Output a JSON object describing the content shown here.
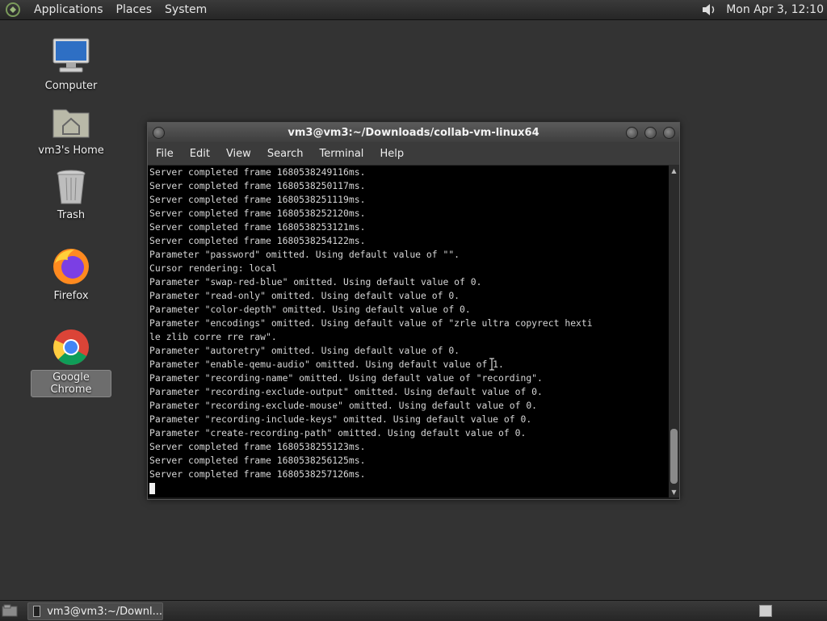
{
  "top_panel": {
    "menus": [
      "Applications",
      "Places",
      "System"
    ],
    "clock": "Mon Apr  3, 12:10"
  },
  "desktop": {
    "icons": [
      {
        "label": "Computer",
        "icon": "computer-icon"
      },
      {
        "label": "vm3's Home",
        "icon": "home-folder-icon"
      },
      {
        "label": "Trash",
        "icon": "trash-icon"
      },
      {
        "label": "Firefox",
        "icon": "firefox-icon"
      },
      {
        "label": "Google Chrome",
        "icon": "chrome-icon"
      }
    ]
  },
  "window": {
    "title": "vm3@vm3:~/Downloads/collab-vm-linux64",
    "menus": [
      "File",
      "Edit",
      "View",
      "Search",
      "Terminal",
      "Help"
    ]
  },
  "terminal": {
    "lines": [
      "Server completed frame 1680538249116ms.",
      "Server completed frame 1680538250117ms.",
      "Server completed frame 1680538251119ms.",
      "Server completed frame 1680538252120ms.",
      "Server completed frame 1680538253121ms.",
      "Server completed frame 1680538254122ms.",
      "Parameter \"password\" omitted. Using default value of \"\".",
      "Cursor rendering: local",
      "Parameter \"swap-red-blue\" omitted. Using default value of 0.",
      "Parameter \"read-only\" omitted. Using default value of 0.",
      "Parameter \"color-depth\" omitted. Using default value of 0.",
      "Parameter \"encodings\" omitted. Using default value of \"zrle ultra copyrect hexti",
      "le zlib corre rre raw\".",
      "Parameter \"autoretry\" omitted. Using default value of 0.",
      "Parameter \"enable-qemu-audio\" omitted. Using default value of 1.",
      "Parameter \"recording-name\" omitted. Using default value of \"recording\".",
      "Parameter \"recording-exclude-output\" omitted. Using default value of 0.",
      "Parameter \"recording-exclude-mouse\" omitted. Using default value of 0.",
      "Parameter \"recording-include-keys\" omitted. Using default value of 0.",
      "Parameter \"create-recording-path\" omitted. Using default value of 0.",
      "Server completed frame 1680538255123ms.",
      "Server completed frame 1680538256125ms.",
      "Server completed frame 1680538257126ms."
    ]
  },
  "taskbar": {
    "task_label": "vm3@vm3:~/Downl..."
  }
}
